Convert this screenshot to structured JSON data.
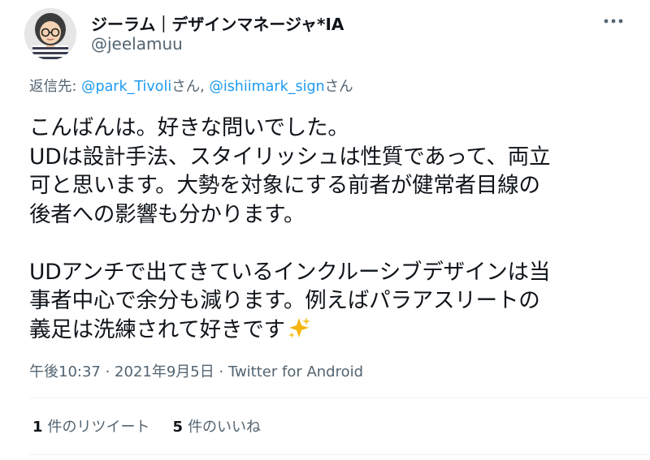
{
  "author": {
    "name": "ジーラム｜デザインマネージャ*IA",
    "handle": "@jeelamuu"
  },
  "reply": {
    "prefix": "返信先: ",
    "mention1": "@park_Tivoli",
    "suffix1": "さん, ",
    "mention2": "@ishiimark_sign",
    "suffix2": "さん"
  },
  "tweet": {
    "lines": [
      "こんばんは。好きな問いでした。",
      "UDは設計手法、スタイリッシュは性質であって、両立",
      "可と思います。大勢を対象にする前者が健常者目線の",
      "後者への影響も分かります。",
      "UDアンチで出てきているインクルーシブデザインは当",
      "事者中心で余分も減ります。例えばパラアスリートの",
      "義足は洗練されて好きです"
    ]
  },
  "meta": {
    "time": "午後10:37",
    "sep1": " · ",
    "date": "2021年9月5日",
    "sep2": " · ",
    "source": "Twitter for Android"
  },
  "stats": {
    "retweets_count": "1",
    "retweets_label": "件のリツイート",
    "likes_count": "5",
    "likes_label": "件のいいね"
  },
  "icons": {
    "more": "more-dots-icon",
    "sparkle": "sparkles-emoji-icon"
  },
  "colors": {
    "link": "#1d9bf0",
    "secondary": "#536471",
    "text": "#0f1419",
    "sparkle": "#f5b50f"
  }
}
